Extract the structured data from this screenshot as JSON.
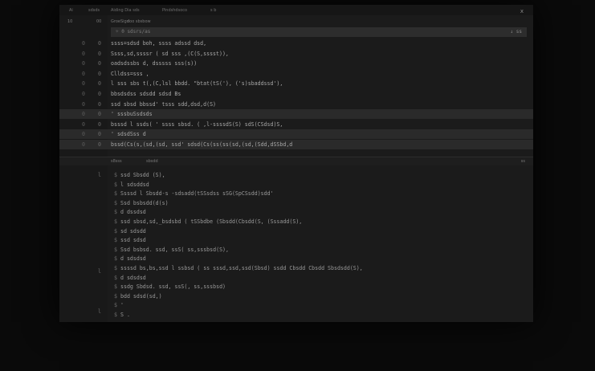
{
  "menubar": {
    "items": [
      "Ai",
      "sdsds",
      "Aiding Dia sds",
      "Pindshdsoco",
      "s b"
    ],
    "close": "x"
  },
  "tabs": {
    "items": [
      "00",
      "GroeSigd",
      "10",
      "doo sbsbow"
    ]
  },
  "find": {
    "label": "☼ 0 sdsrs/as",
    "options": "↓ ss"
  },
  "editor": {
    "lines": [
      {
        "num": "0",
        "mark": "0",
        "code": "ssss=sdsd boh, ssss adssd dsd,"
      },
      {
        "num": "0",
        "mark": "0",
        "code": "Ssss,sd,ssssr ( sd sss ,(C(S,sssst)),"
      },
      {
        "num": "0",
        "mark": "0",
        "code": "oadsdssbs d, dsssss sss(s))"
      },
      {
        "num": "0",
        "mark": "0",
        "code": "Clldss=sss         ,"
      },
      {
        "num": "0",
        "mark": "0",
        "code": "l sss sbs t(,(C,lsl bbdd. \"btat(tS('), ('s)sbaddssd'),"
      },
      {
        "num": "0",
        "mark": "0",
        "code": "bbsdsdss sdsdd  sdsd  Bs"
      },
      {
        "num": "0",
        "mark": "0",
        "code": "ssd sbsd  bbssd'  tsss  sdd,dsd,d(S)"
      },
      {
        "num": "0",
        "mark": "0",
        "code": "' sssbuSsdsds"
      },
      {
        "num": "0",
        "mark": "0",
        "code": "bsssd   l ssds( ' ssss sbsd. ( ,l-ssssdS(S) sdS(CSdsd)S,"
      },
      {
        "num": "0",
        "mark": "0",
        "code": "' sdsdSss d"
      },
      {
        "num": "0",
        "mark": "0",
        "code": "bssd(Cs(s,(sd,(sd, ssd' sdsd(Cs(ss(ss(sd,(sd,(Sdd,dSSbd,d"
      }
    ]
  },
  "panel": {
    "tabs": [
      "s8sss",
      "sbsdd"
    ],
    "more": "ss"
  },
  "terminal": {
    "lines": [
      {
        "gutter": "$",
        "text": "ssd    Sbsdd  (S),"
      },
      {
        "gutter": "$",
        "text": "l sdsddsd"
      },
      {
        "gutter": "$",
        "text": "Ssssd  l Sbsdd-s -sdsadd(tSSsdss sSG(SpCSsdd)sdd'"
      },
      {
        "gutter": "$",
        "text": "Ssd  bsbsdd(d(s)"
      },
      {
        "gutter": "$",
        "text": "d dssdsd"
      },
      {
        "gutter": "$",
        "text": "ssd  sbsd,sd,_bsdsbd ( tSSbdbe  (Sbsdd(Cbsdd(S,  (Sssadd(S),"
      },
      {
        "gutter": "$",
        "text": "sd sdsdd"
      },
      {
        "gutter": "$",
        "text": "ssd  sdsd"
      },
      {
        "gutter": "$",
        "text": "Ssd  bsbsd.  ssd, ssS( ss,sssbsd(S),"
      },
      {
        "gutter": "$",
        "text": "d  sdsdsd"
      },
      {
        "gutter": "$",
        "text": "ssssd    bs,bs,ssd l ssbsd ( ss  sssd,ssd,ssd(Sbsd)  ssdd Cbsdd  Cbsdd  Sbsdsdd(S),"
      },
      {
        "gutter": "$",
        "text": "d  sdsdsd"
      },
      {
        "gutter": "$",
        "text": "ssdg  Sbdsd.  ssd, ssS(, ss,sssbsd)"
      },
      {
        "gutter": "$",
        "text": "bdd  sdsd(sd,)"
      },
      {
        "gutter": "$",
        "text": "'"
      },
      {
        "gutter": "$",
        "text": "S ."
      }
    ],
    "side_marks": [
      "l",
      "l",
      "l"
    ]
  },
  "colors": {
    "background": "#0a0a0a",
    "editor_bg": "#1b1b1b",
    "highlight": "#2a2a2a",
    "text": "#a8a8a8"
  }
}
